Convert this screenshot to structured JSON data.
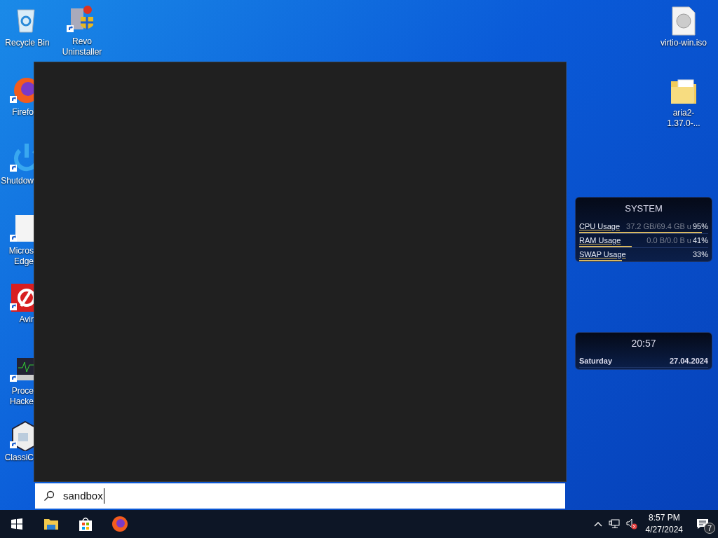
{
  "desktop_icons": [
    {
      "kind": "recycle",
      "label": "Recycle Bin"
    },
    {
      "kind": "revo",
      "label": "Revo Uninstaller"
    },
    {
      "kind": "firefox",
      "label": "Firefo"
    },
    {
      "kind": "power",
      "label": "Shutdow"
    },
    {
      "kind": "doc",
      "label": "Micros Edge"
    },
    {
      "kind": "avira",
      "label": "Avir"
    },
    {
      "kind": "monitor",
      "label": "Proce Hacke"
    },
    {
      "kind": "cube",
      "label": "ClassiC"
    },
    {
      "kind": "disc",
      "label": "virtio-win.iso"
    },
    {
      "kind": "folder",
      "label": "aria2-1.37.0-..."
    }
  ],
  "search": {
    "value": "sandbox"
  },
  "system_widget": {
    "title": "SYSTEM",
    "rows": [
      {
        "label": "CPU Usage",
        "detail": "37.2 GB/69.4 GB u",
        "value": "95%",
        "level": 0.95
      },
      {
        "label": "RAM Usage",
        "detail": "0.0 B/0.0 B u",
        "value": "41%",
        "level": 0.41
      },
      {
        "label": "SWAP Usage",
        "value": "33%",
        "level": 0.33
      }
    ]
  },
  "clock_widget": {
    "time": "20:57",
    "day": "Saturday",
    "date": "27.04.2024"
  },
  "taskbar": {
    "apps": [
      {
        "kind": "explorer"
      },
      {
        "kind": "store"
      },
      {
        "kind": "firefox"
      }
    ],
    "time": "8:57 PM",
    "date": "4/27/2024",
    "notifications": "7"
  }
}
